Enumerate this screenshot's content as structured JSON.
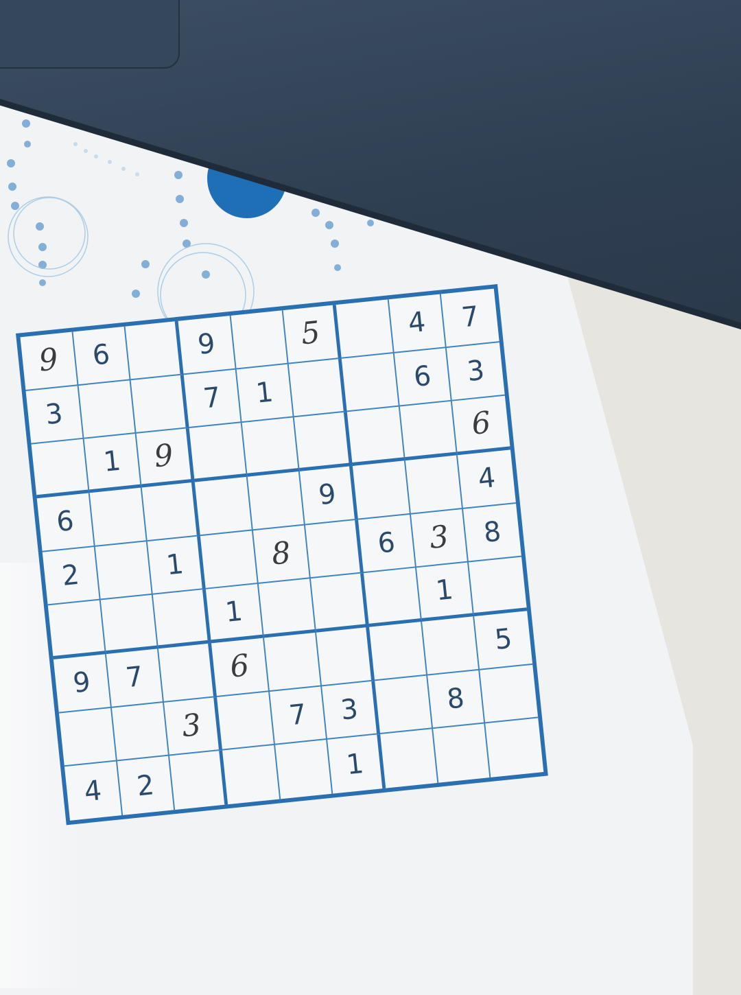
{
  "scene": {
    "description_colors": {
      "grid_line": "#2a6fb1",
      "printed_digit": "#2b4a6b",
      "handwritten_digit": "#3a3c40",
      "laptop": "#2f3f52",
      "paper": "#f2f3f5"
    }
  },
  "sudoku": {
    "rows": [
      [
        {
          "v": "9",
          "hand": true
        },
        {
          "v": "6"
        },
        {
          "v": ""
        },
        {
          "v": "9"
        },
        {
          "v": ""
        },
        {
          "v": "5",
          "hand": true
        },
        {
          "v": ""
        },
        {
          "v": "4"
        },
        {
          "v": "7"
        }
      ],
      [
        {
          "v": "3"
        },
        {
          "v": ""
        },
        {
          "v": ""
        },
        {
          "v": "7"
        },
        {
          "v": "1"
        },
        {
          "v": ""
        },
        {
          "v": ""
        },
        {
          "v": "6"
        },
        {
          "v": "3"
        }
      ],
      [
        {
          "v": ""
        },
        {
          "v": "1"
        },
        {
          "v": "9",
          "hand": true
        },
        {
          "v": ""
        },
        {
          "v": ""
        },
        {
          "v": ""
        },
        {
          "v": ""
        },
        {
          "v": ""
        },
        {
          "v": "6",
          "hand": true
        }
      ],
      [
        {
          "v": "6"
        },
        {
          "v": ""
        },
        {
          "v": ""
        },
        {
          "v": ""
        },
        {
          "v": ""
        },
        {
          "v": "9"
        },
        {
          "v": ""
        },
        {
          "v": ""
        },
        {
          "v": "4"
        }
      ],
      [
        {
          "v": "2"
        },
        {
          "v": ""
        },
        {
          "v": "1"
        },
        {
          "v": ""
        },
        {
          "v": "8",
          "hand": true
        },
        {
          "v": ""
        },
        {
          "v": "6"
        },
        {
          "v": "3",
          "hand": true
        },
        {
          "v": "8"
        }
      ],
      [
        {
          "v": ""
        },
        {
          "v": ""
        },
        {
          "v": ""
        },
        {
          "v": "1"
        },
        {
          "v": ""
        },
        {
          "v": ""
        },
        {
          "v": ""
        },
        {
          "v": "1"
        },
        {
          "v": ""
        }
      ],
      [
        {
          "v": "9"
        },
        {
          "v": "7"
        },
        {
          "v": ""
        },
        {
          "v": "6",
          "hand": true
        },
        {
          "v": ""
        },
        {
          "v": ""
        },
        {
          "v": ""
        },
        {
          "v": ""
        },
        {
          "v": "5"
        }
      ],
      [
        {
          "v": ""
        },
        {
          "v": ""
        },
        {
          "v": "3",
          "hand": true
        },
        {
          "v": ""
        },
        {
          "v": "7"
        },
        {
          "v": "3"
        },
        {
          "v": ""
        },
        {
          "v": "8"
        },
        {
          "v": ""
        }
      ],
      [
        {
          "v": "4"
        },
        {
          "v": "2"
        },
        {
          "v": ""
        },
        {
          "v": ""
        },
        {
          "v": ""
        },
        {
          "v": "1"
        },
        {
          "v": ""
        },
        {
          "v": ""
        },
        {
          "v": ""
        }
      ]
    ]
  }
}
